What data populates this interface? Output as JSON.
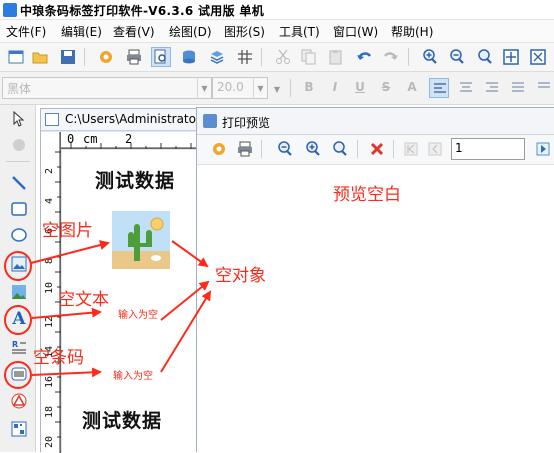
{
  "window": {
    "title": "中琅条码标签打印软件-V6.3.6 试用版 单机"
  },
  "menu": [
    "文件(F)",
    "编辑(E)",
    "查看(V)",
    "绘图(D)",
    "图形(S)",
    "工具(T)",
    "窗口(W)",
    "帮助(H)"
  ],
  "font_toolbar": {
    "font_name": "黑体",
    "font_size": "20.0"
  },
  "document": {
    "path": "C:\\Users\\Administrator",
    "hruler_labels": [
      "0",
      "cm",
      "2"
    ],
    "vruler_labels": [
      "2",
      "4",
      "6",
      "8",
      "10",
      "12",
      "14",
      "16",
      "18",
      "20"
    ]
  },
  "canvas": {
    "top_text": "测试数据",
    "bottom_text": "测试数据",
    "placeholder_text_1": "输入为空",
    "placeholder_text_2": "输入为空"
  },
  "preview": {
    "title": "打印预览",
    "page_input": "1"
  },
  "annotations": {
    "empty_image": "空图片",
    "empty_text": "空文本",
    "empty_barcode": "空条码",
    "empty_object": "空对象",
    "preview_blank": "预览空白"
  },
  "colors": {
    "annotation": "#ff2a1a",
    "accent": "#2a7de1"
  }
}
